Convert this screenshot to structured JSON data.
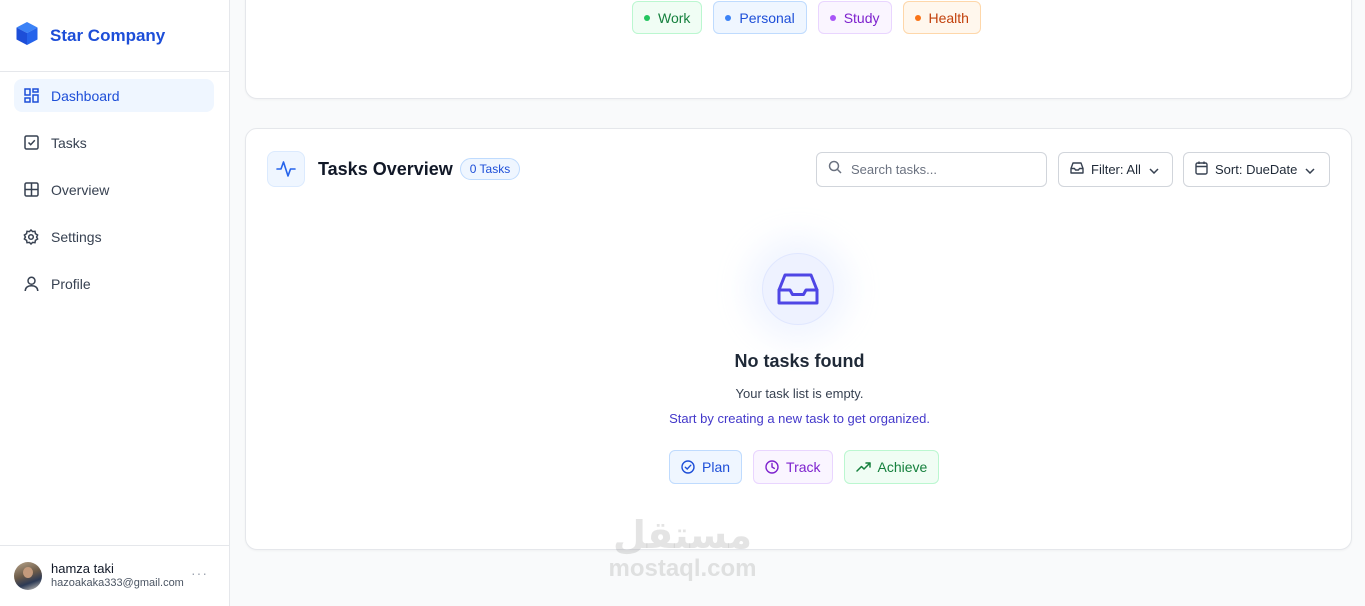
{
  "sidebar": {
    "brand": "Star Company",
    "items": [
      {
        "label": "Dashboard",
        "icon": "dashboard-icon",
        "active": true
      },
      {
        "label": "Tasks",
        "icon": "checkbox-icon"
      },
      {
        "label": "Overview",
        "icon": "grid-icon"
      },
      {
        "label": "Settings",
        "icon": "gear-icon"
      },
      {
        "label": "Profile",
        "icon": "user-icon"
      }
    ],
    "user": {
      "name": "hamza taki",
      "email": "hazoakaka333@gmail.com",
      "more": "···"
    }
  },
  "categories": [
    "Work",
    "Personal",
    "Study",
    "Health"
  ],
  "overview": {
    "title": "Tasks Overview",
    "count_badge": "0 Tasks",
    "search_placeholder": "Search tasks...",
    "filter_label": "Filter: All",
    "sort_label": "Sort: DueDate"
  },
  "empty": {
    "title": "No tasks found",
    "subtitle": "Your task list is empty.",
    "hint": "Start by creating a new task to get organized.",
    "pills": [
      "Plan",
      "Track",
      "Achieve"
    ]
  },
  "watermark": {
    "arabic": "مستقل",
    "latin": "mostaql.com"
  },
  "colors": {
    "accent": "#1d4ed8",
    "indigo": "#4f46e5",
    "green": "#22c55e",
    "purple": "#a855f7",
    "orange": "#f97316"
  }
}
